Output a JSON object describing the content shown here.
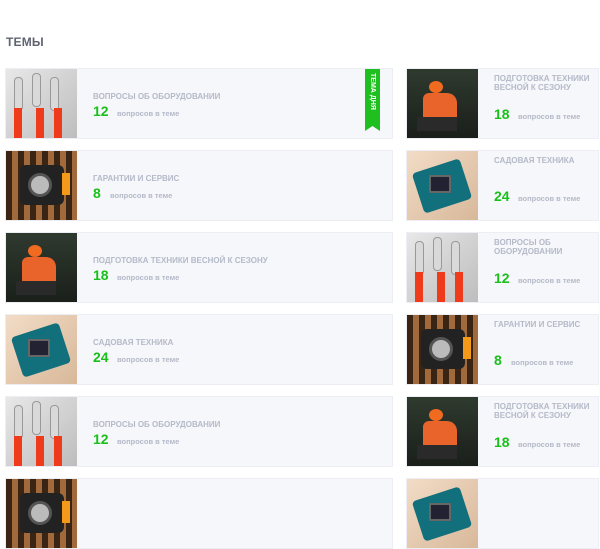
{
  "section_title": "ТЕМЫ",
  "badge": "ТЕМА ДНЯ",
  "colors": {
    "accent_green": "#19c019",
    "card_bg": "#f6f7fb",
    "muted_text": "#b5bac8"
  },
  "topics": {
    "left": [
      {
        "title": "ВОПРОСЫ ОБ ОБОРУДОВАНИИ",
        "count": "12",
        "sub": "вопросов в теме",
        "image": "pliers"
      },
      {
        "title": "ГАРАНТИИ И СЕРВИС",
        "count": "8",
        "sub": "вопросов в теме",
        "image": "fence"
      },
      {
        "title": "ПОДГОТОВКА ТЕХНИКИ ВЕСНОЙ К СЕЗОНУ",
        "count": "18",
        "sub": "вопросов в теме",
        "image": "worker"
      },
      {
        "title": "САДОВАЯ ТЕХНИКА",
        "count": "24",
        "sub": "вопросов в теме",
        "image": "garden"
      },
      {
        "title": "ВОПРОСЫ ОБ ОБОРУДОВАНИИ",
        "count": "12",
        "sub": "вопросов в теме",
        "image": "pliers"
      },
      {
        "title": "",
        "count": "",
        "sub": "",
        "image": "fence"
      }
    ],
    "right": [
      {
        "title": "ПОДГОТОВКА ТЕХНИКИ ВЕСНОЙ К СЕЗОНУ",
        "count": "18",
        "sub": "вопросов в теме",
        "image": "worker"
      },
      {
        "title": "САДОВАЯ ТЕХНИКА",
        "count": "24",
        "sub": "вопросов в теме",
        "image": "garden"
      },
      {
        "title": "ВОПРОСЫ ОБ ОБОРУДОВАНИИ",
        "count": "12",
        "sub": "вопросов в теме",
        "image": "pliers"
      },
      {
        "title": "ГАРАНТИИ И СЕРВИС",
        "count": "8",
        "sub": "вопросов в теме",
        "image": "fence"
      },
      {
        "title": "ПОДГОТОВКА ТЕХНИКИ ВЕСНОЙ К СЕЗОНУ",
        "count": "18",
        "sub": "вопросов в теме",
        "image": "worker"
      },
      {
        "title": "",
        "count": "",
        "sub": "",
        "image": "garden"
      }
    ]
  }
}
